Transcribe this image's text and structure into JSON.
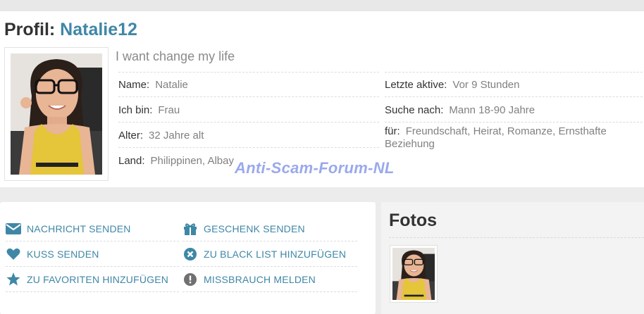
{
  "profile": {
    "title_prefix": "Profil:",
    "username": "Natalie12",
    "headline": "I want change my life",
    "left_fields": [
      {
        "label": "Name:",
        "value": "Natalie"
      },
      {
        "label": "Ich bin:",
        "value": "Frau"
      },
      {
        "label": "Alter:",
        "value": "32 Jahre alt"
      },
      {
        "label": "Land:",
        "value": "Philippinen, Albay"
      }
    ],
    "right_fields": [
      {
        "label": "Letzte aktive:",
        "value": "Vor 9 Stunden"
      },
      {
        "label": "Suche nach:",
        "value": "Mann 18-90 Jahre"
      },
      {
        "label": "für:",
        "value": "Freundschaft, Heirat, Romanze, Ernsthafte Beziehung"
      }
    ]
  },
  "watermark": "Anti-Scam-Forum-NL",
  "actions": [
    {
      "label": "NACHRICHT SENDEN",
      "icon": "envelope-icon"
    },
    {
      "label": "GESCHENK SENDEN",
      "icon": "gift-icon"
    },
    {
      "label": "KUSS SENDEN",
      "icon": "heart-icon"
    },
    {
      "label": "ZU BLACK LIST HINZUFÜGEN",
      "icon": "x-circle-icon"
    },
    {
      "label": "ZU FAVORITEN HINZUFÜGEN",
      "icon": "star-icon"
    },
    {
      "label": "MISSBRAUCH MELDEN",
      "icon": "alert-icon"
    }
  ],
  "photos": {
    "title": "Fotos"
  },
  "colors": {
    "accent": "#3f87a6",
    "label": "#333333",
    "value": "#808080",
    "icon": "#3f87a6",
    "icon_gray": "#707070"
  }
}
